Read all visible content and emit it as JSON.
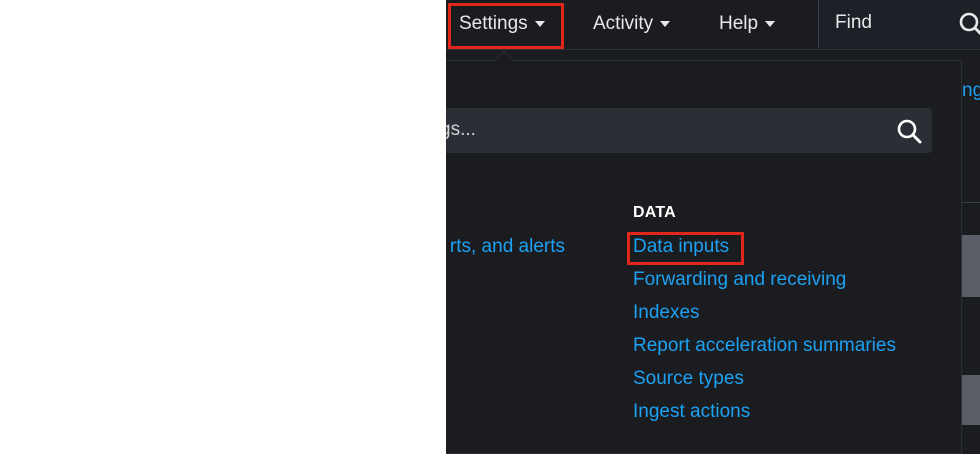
{
  "topbar": {
    "settings_label": "Settings",
    "activity_label": "Activity",
    "help_label": "Help",
    "find_placeholder": "Find"
  },
  "settings_menu": {
    "search_placeholder_visible": "gs...",
    "left_column_visible_link": "rts, and alerts",
    "data_section": {
      "heading": "DATA",
      "links": [
        "Data inputs",
        "Forwarding and receiving",
        "Indexes",
        "Report acceleration summaries",
        "Source types",
        "Ingest actions"
      ]
    }
  },
  "right_edge": {
    "partial_link": "ng"
  },
  "colors": {
    "background": "#1a1c20",
    "link": "#1da1f2",
    "highlight": "#e1261c",
    "text": "#e8e8ea"
  }
}
